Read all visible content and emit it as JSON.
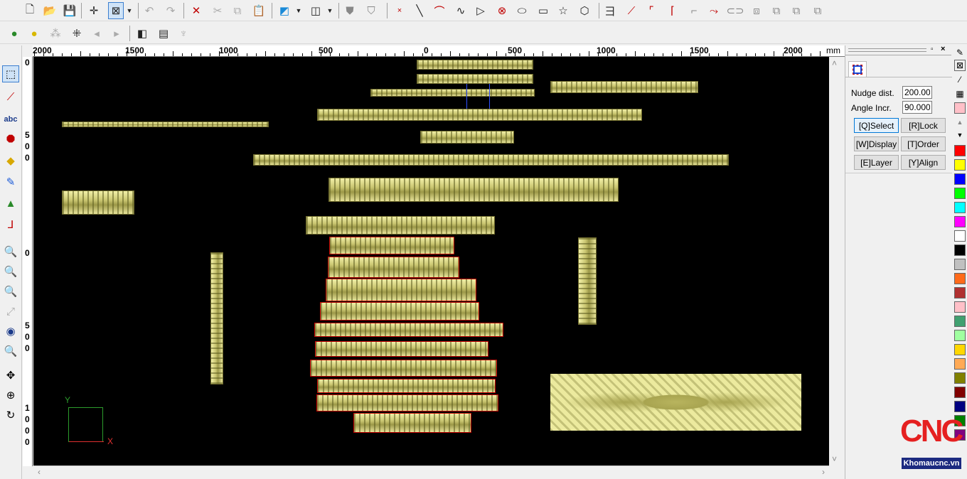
{
  "ruler": {
    "unit": "mm",
    "h_labels": [
      "2000",
      "1500",
      "1000",
      "500",
      "0",
      "500",
      "1000",
      "1500",
      "2000"
    ],
    "v_labels": [
      "0",
      "5",
      "0",
      "0",
      "0",
      "5",
      "0",
      "0",
      "1",
      "0",
      "0",
      "0"
    ]
  },
  "axes": {
    "x_label": "X",
    "y_label": "Y"
  },
  "panel": {
    "nudge_label": "Nudge dist.",
    "nudge_value": "200.000",
    "angle_label": "Angle Incr.",
    "angle_value": "90.000",
    "buttons": {
      "select": "[Q]Select",
      "lock": "[R]Lock",
      "display": "[W]Display",
      "order": "[T]Order",
      "layer": "[E]Layer",
      "align": "[Y]Align"
    }
  },
  "palette": [
    "#ff0000",
    "#ffff00",
    "#0000ff",
    "#00ff00",
    "#00ffff",
    "#ff00ff",
    "#ffffff",
    "#000000",
    "#c0c0c0",
    "#ff6a1a",
    "#b03030",
    "#ffc0c8",
    "#40a070",
    "#a0ffa0",
    "#ffd700",
    "#ffaa55",
    "#808000",
    "#800000",
    "#000080",
    "#008000",
    "#800080"
  ],
  "logo": {
    "text": "CNC",
    "site": "Khomaucnc.vn"
  },
  "icons": [
    "new-file-icon",
    "open-folder-icon",
    "save-icon",
    "crosshair-icon",
    "select-box-icon",
    "undo-icon",
    "redo-icon",
    "delete-icon",
    "cut-icon",
    "copy-icon",
    "paste-icon"
  ]
}
